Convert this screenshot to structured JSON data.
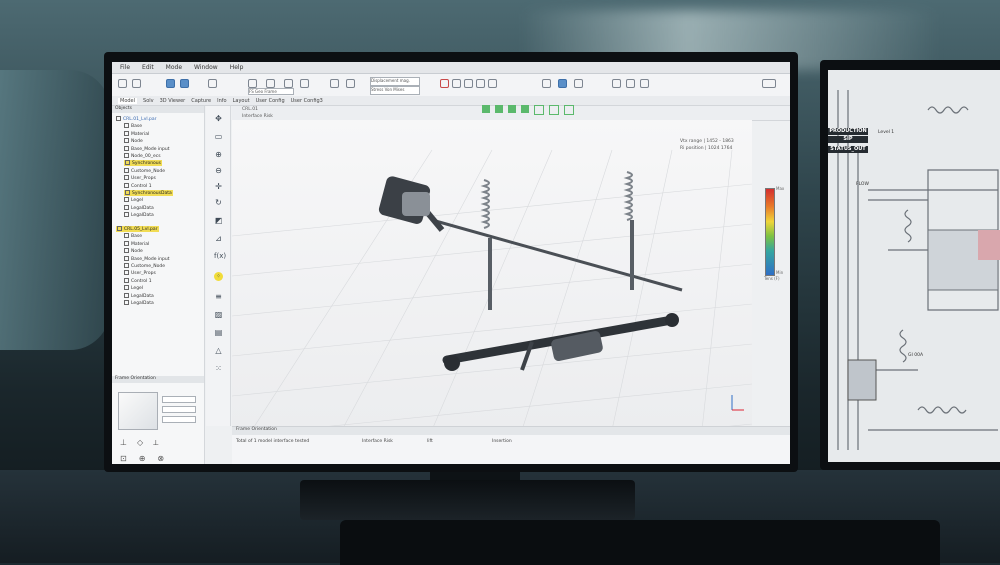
{
  "menu": [
    "File",
    "Edit",
    "Mode",
    "Window",
    "Help"
  ],
  "toolbar": {
    "select1": "Displacement mag.",
    "select2": "Stress Von Mises",
    "select3": "FS Geo Frame"
  },
  "tabs": [
    "Model",
    "Solv",
    "3D Viewer",
    "Capture",
    "Info",
    "Layout",
    "User Config",
    "User Config3"
  ],
  "tree1": {
    "header": "Objects",
    "items": [
      {
        "label": "CRL.01_Lvl.par",
        "style": "blue"
      },
      {
        "label": "Base",
        "style": ""
      },
      {
        "label": "Material",
        "style": ""
      },
      {
        "label": "Node",
        "style": ""
      },
      {
        "label": "Base_Mode input",
        "style": ""
      },
      {
        "label": "Node_00_ecs",
        "style": ""
      },
      {
        "label": "Synchronous",
        "style": "hl"
      },
      {
        "label": "Custome_Node",
        "style": ""
      },
      {
        "label": "User_Props",
        "style": ""
      },
      {
        "label": "Control 1",
        "style": ""
      },
      {
        "label": "SynchronousData",
        "style": "hl"
      },
      {
        "label": "Legel",
        "style": ""
      },
      {
        "label": "LegalData",
        "style": ""
      },
      {
        "label": "LegalData",
        "style": ""
      }
    ]
  },
  "tree2": {
    "items": [
      {
        "label": "CRL.05_Lvl.par",
        "style": "hl"
      },
      {
        "label": "Base",
        "style": ""
      },
      {
        "label": "Material",
        "style": ""
      },
      {
        "label": "Node",
        "style": ""
      },
      {
        "label": "Base_Mode input",
        "style": ""
      },
      {
        "label": "Custome_Node",
        "style": ""
      },
      {
        "label": "User_Props",
        "style": ""
      },
      {
        "label": "Control 1",
        "style": ""
      },
      {
        "label": "Legel",
        "style": ""
      },
      {
        "label": "LegalData",
        "style": ""
      },
      {
        "label": "LegalData",
        "style": ""
      }
    ]
  },
  "orientation_panel": {
    "title": "Frame Orientation"
  },
  "viewport": {
    "tab": "CRL.01",
    "sublabel": "Interface Risk",
    "info1": "Vtx range | 1452 - 1863",
    "info2": "Ri position | 1024 1764"
  },
  "colorbar": {
    "ticks": [
      "Max",
      "",
      "",
      "",
      "",
      "",
      "",
      "Min"
    ],
    "unit": "Tens (F)"
  },
  "bottom_panel": {
    "title": "Frame Orientation",
    "row1": "Total of 1 model interface tested",
    "row2": "Interface Risk",
    "row3": "lift",
    "row4": "Insertion"
  },
  "screen2": {
    "badge1": "PRODUCTION",
    "badge2": "SIP",
    "badge3": "STATUS_OUT",
    "flow": "FLOW",
    "label": "GI 00A",
    "note": "Level 1"
  }
}
